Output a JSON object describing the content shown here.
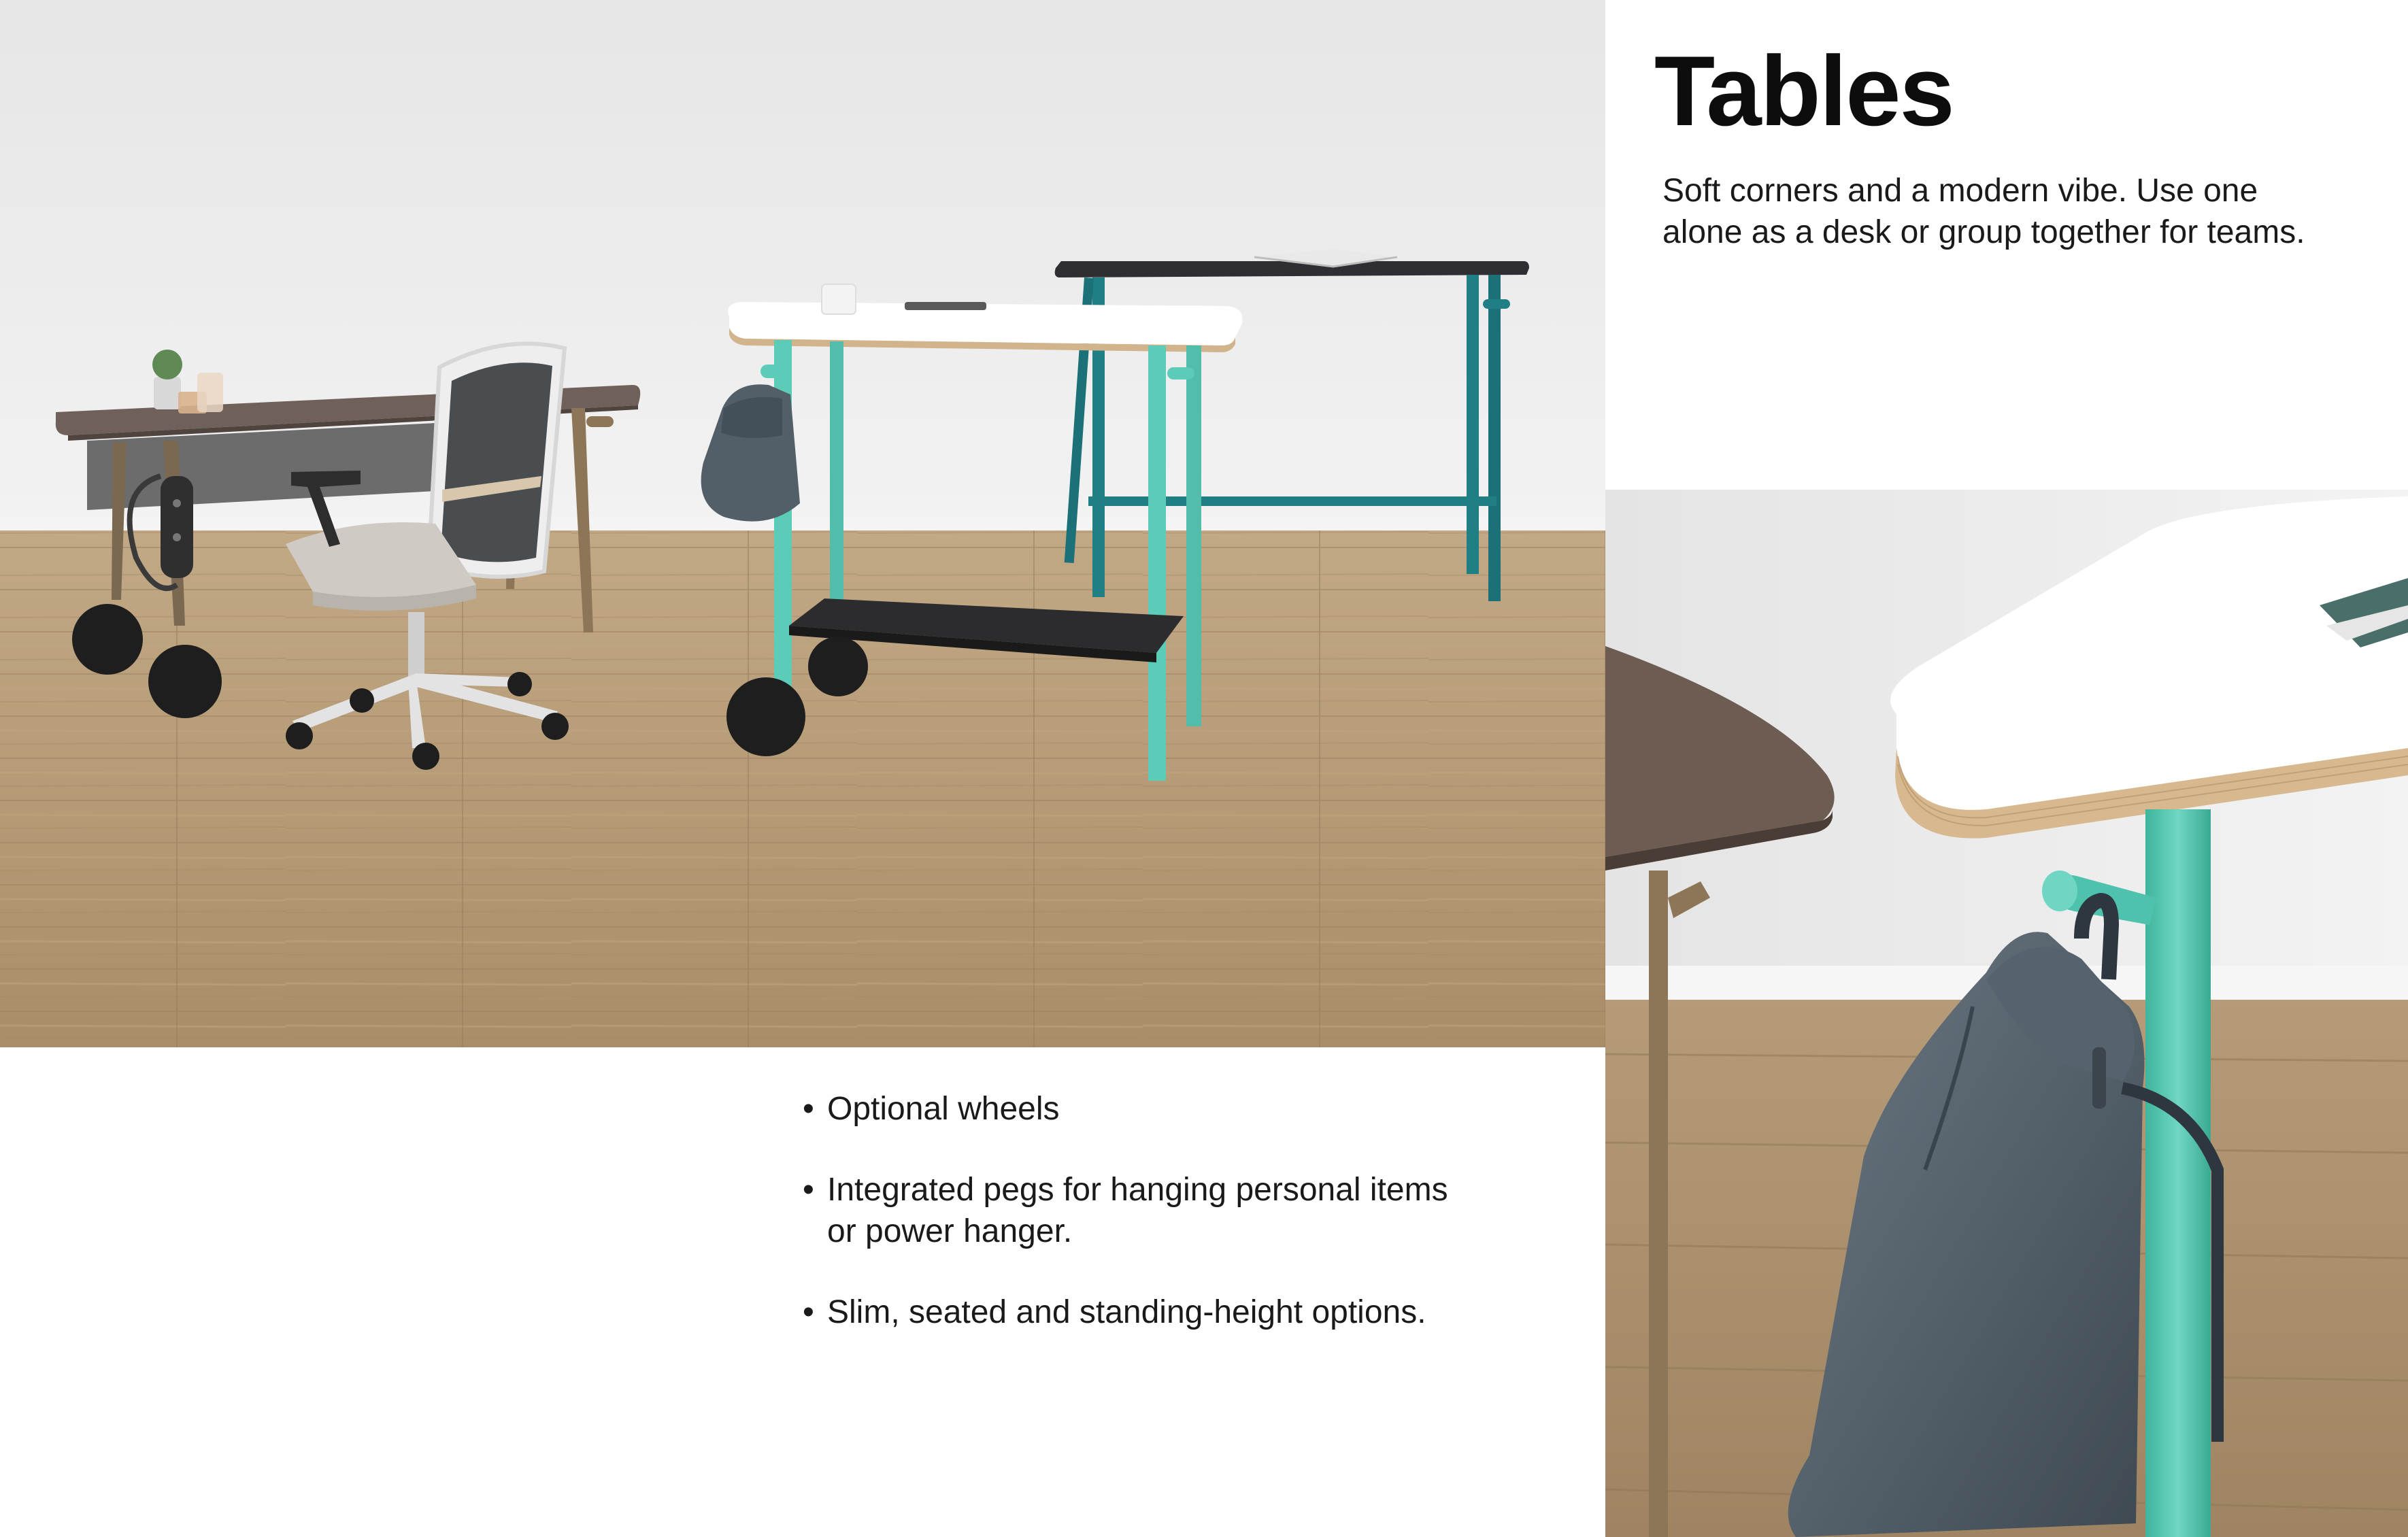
{
  "header": {
    "title": "Tables",
    "subtitle": "Soft corners and a modern vibe. Use one alone as a desk or group together for teams."
  },
  "features": [
    "Optional wheels",
    "Integrated pegs for hanging personal items or power hanger.",
    "Slim, seated and standing-height options."
  ],
  "colors": {
    "floor": "#b39a78",
    "wall": "#ececec",
    "teal_light": "#5ccbb8",
    "teal_dark": "#1f7f85",
    "walnut": "#6f6159",
    "bag": "#525f69"
  }
}
